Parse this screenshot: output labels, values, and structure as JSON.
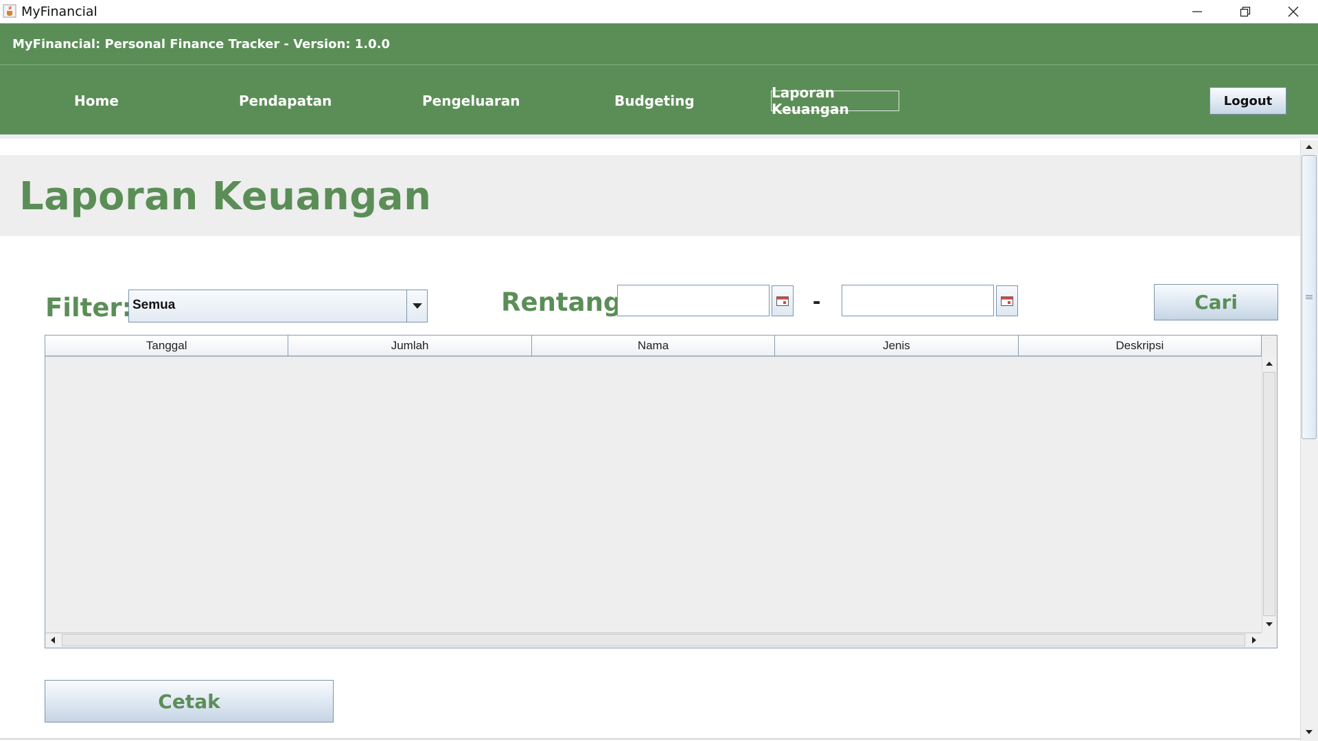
{
  "window": {
    "title": "MyFinancial"
  },
  "header": {
    "version_text": "MyFinancial: Personal Finance Tracker - Version: 1.0.0",
    "nav": {
      "home": "Home",
      "pendapatan": "Pendapatan",
      "pengeluaran": "Pengeluaran",
      "budgeting": "Budgeting",
      "laporan": "Laporan Keuangan"
    },
    "logout_label": "Logout",
    "active_nav": "laporan"
  },
  "page": {
    "title": "Laporan Keuangan"
  },
  "filter": {
    "label": "Filter:",
    "selected": "Semua"
  },
  "range": {
    "label": "Rentang:",
    "from_value": "",
    "to_value": "",
    "separator": "-"
  },
  "search": {
    "button_label": "Cari"
  },
  "table": {
    "columns": [
      "Tanggal",
      "Jumlah",
      "Nama",
      "Jenis",
      "Deskripsi"
    ],
    "rows": []
  },
  "print": {
    "button_label": "Cetak"
  },
  "colors": {
    "brand_green": "#5b8e57",
    "button_border": "#7a93ad",
    "panel_gray": "#eeeeee"
  },
  "icons": {
    "app": "java-cup-icon",
    "calendar": "calendar-icon",
    "dropdown": "chevron-down-icon"
  }
}
